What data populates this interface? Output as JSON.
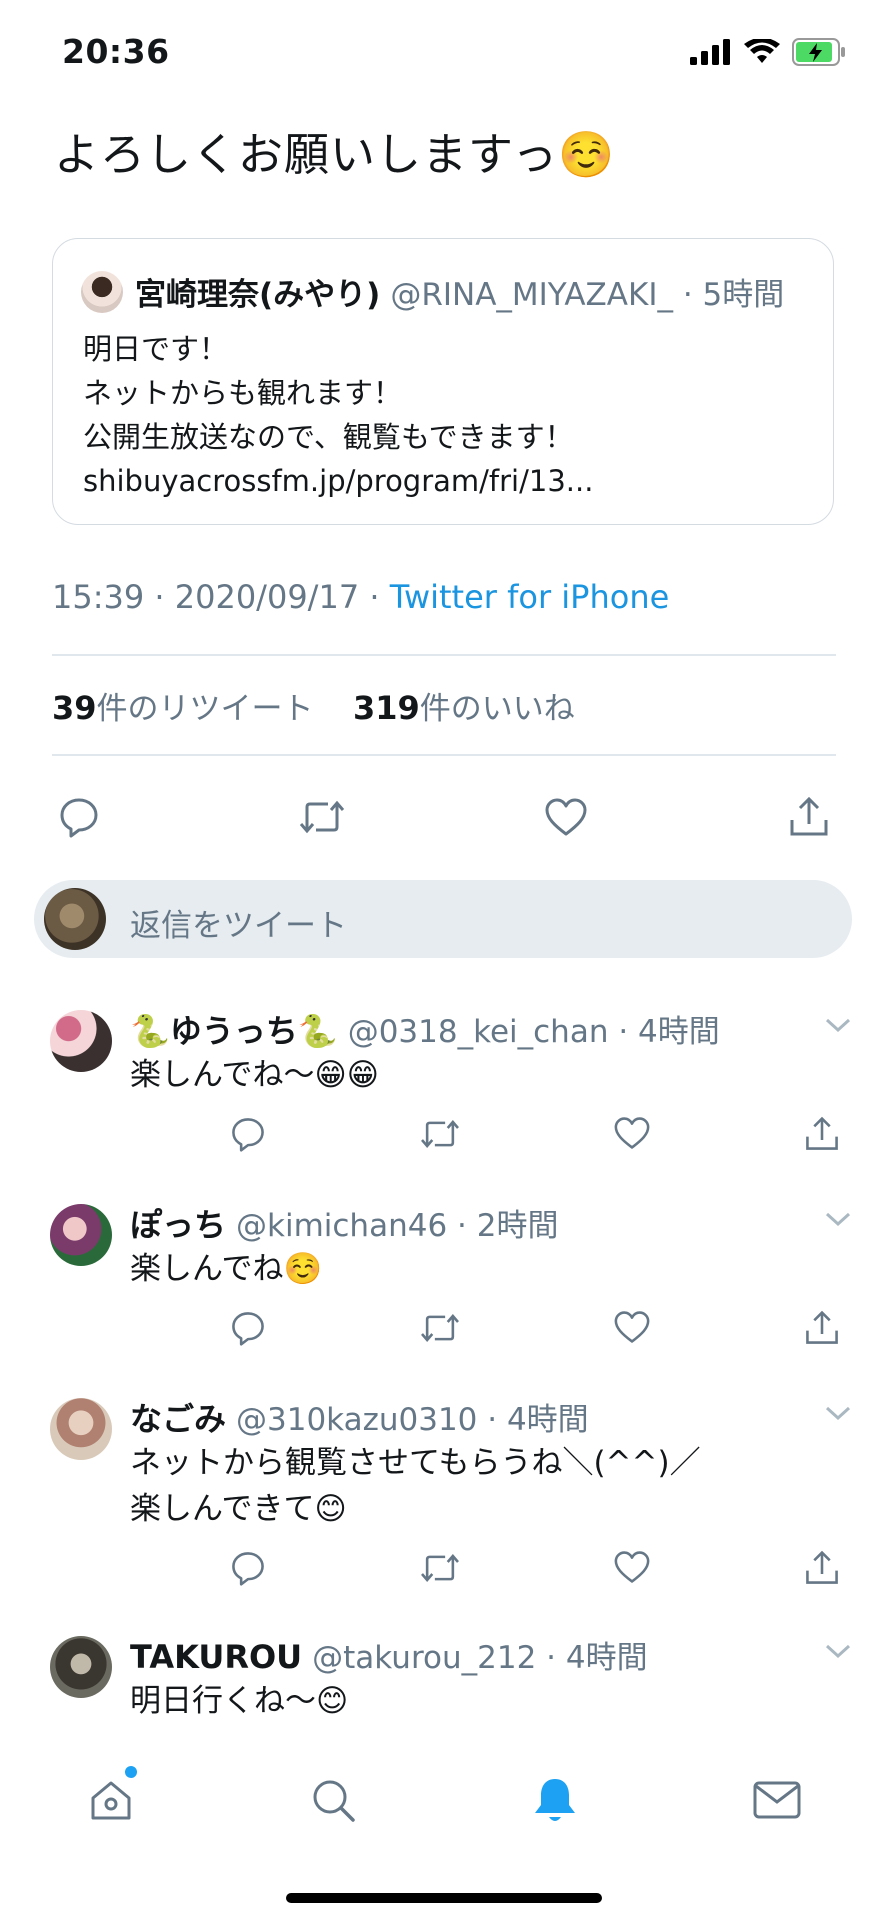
{
  "status": {
    "time": "20:36"
  },
  "tweet": {
    "text": "よろしくお願いしますっ☺️",
    "quote": {
      "name": "宮崎理奈(みやり)",
      "handle": "@RINA_MIYAZAKI_ · 5時間",
      "lines": [
        "明日です！",
        "ネットからも観れます！",
        "公開生放送なので、観覧もできます！",
        "shibuyacrossfm.jp/program/fri/13..."
      ]
    },
    "meta_time": "15:39 · 2020/09/17 · ",
    "meta_source": "Twitter for iPhone",
    "retweets": "39",
    "retweets_label": "件のリツイート",
    "likes": "319",
    "likes_label": "件のいいね"
  },
  "reply_box": {
    "placeholder": "返信をツイート"
  },
  "replies": [
    {
      "name": "🐍ゆうっち🐍",
      "handle": "@0318_kei_chan · 4時間",
      "lines": [
        "楽しんでね〜😁😁"
      ]
    },
    {
      "name": "ぽっち",
      "handle": "@kimichan46 · 2時間",
      "lines": [
        "楽しんでね☺️"
      ]
    },
    {
      "name": "なごみ",
      "handle": "@310kazu0310 · 4時間",
      "lines": [
        "ネットから観覧させてもらうね＼(^^)／",
        "楽しんできて😊"
      ]
    },
    {
      "name": "TAKUROU",
      "handle": "@takurou_212 · 4時間",
      "lines": [
        "明日行くね〜😊"
      ]
    }
  ],
  "colors": {
    "accent": "#1da1f2",
    "secondary_text": "#657786",
    "link": "#1b95e0",
    "battery": "#4cd964"
  },
  "tabs": [
    "home-icon",
    "search-icon",
    "notifications-icon",
    "messages-icon"
  ]
}
